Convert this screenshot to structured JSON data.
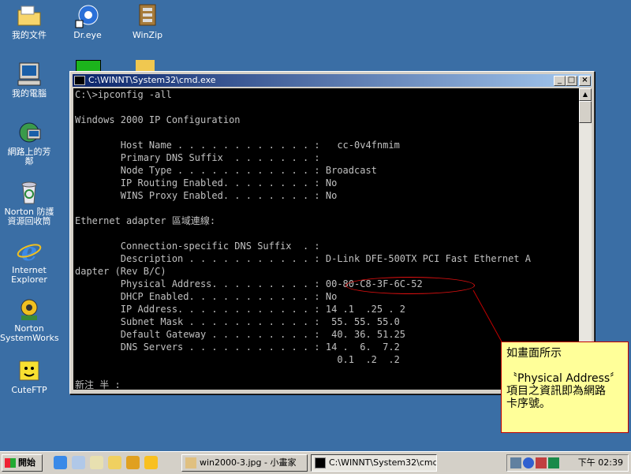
{
  "desktop": {
    "icons": [
      {
        "label": "我的文件",
        "icon": "folder-icon"
      },
      {
        "label": "Dr.eye",
        "icon": "dreye-icon"
      },
      {
        "label": "WinZip",
        "icon": "winzip-icon"
      },
      {
        "label": "我的電腦",
        "icon": "computer-icon"
      },
      {
        "label": "網路上的芳\n鄰",
        "icon": "network-icon"
      },
      {
        "label": "Norton 防護\n資源回收筒",
        "icon": "recycle-bin-icon"
      },
      {
        "label": "Internet\nExplorer",
        "icon": "ie-icon"
      },
      {
        "label": "Norton\nSystemWorks",
        "icon": "norton-icon"
      },
      {
        "label": "CuteFTP",
        "icon": "cuteftp-icon"
      }
    ]
  },
  "window": {
    "title": "C:\\WINNT\\System32\\cmd.exe",
    "minimize": "_",
    "maximize": "□",
    "close": "×"
  },
  "console": {
    "lines": [
      "C:\\>ipconfig -all",
      "",
      "Windows 2000 IP Configuration",
      "",
      "        Host Name . . . . . . . . . . . . :   cc-0v4fnmim",
      "        Primary DNS Suffix  . . . . . . . :",
      "        Node Type . . . . . . . . . . . . : Broadcast",
      "        IP Routing Enabled. . . . . . . . : No",
      "        WINS Proxy Enabled. . . . . . . . : No",
      "",
      "Ethernet adapter 區域連線:",
      "",
      "        Connection-specific DNS Suffix  . :",
      "        Description . . . . . . . . . . . : D-Link DFE-500TX PCI Fast Ethernet A",
      "dapter (Rev B/C)",
      "        Physical Address. . . . . . . . . : 00-80-C8-3F-6C-52",
      "        DHCP Enabled. . . . . . . . . . . : No",
      "        IP Address. . . . . . . . . . . . : 14 .1  .25 . 2",
      "        Subnet Mask . . . . . . . . . . . :  55. 55. 55.0",
      "        Default Gateway . . . . . . . . . :  40. 36. 51.25",
      "        DNS Servers . . . . . . . . . . . : 14 .  6.  7.2",
      "                                              0.1  .2  .2",
      "",
      "新注 半 :"
    ]
  },
  "note": {
    "line1": "如畫面所示",
    "line2": "〝Physical Address〞",
    "line3": "項目之資訊即為網路",
    "line4": "卡序號。"
  },
  "taskbar": {
    "start": "開始",
    "tasks": [
      {
        "label": "win2000-3.jpg - 小畫家"
      },
      {
        "label": "C:\\WINNT\\System32\\cmd...."
      }
    ],
    "clock": "下午 02:39"
  }
}
